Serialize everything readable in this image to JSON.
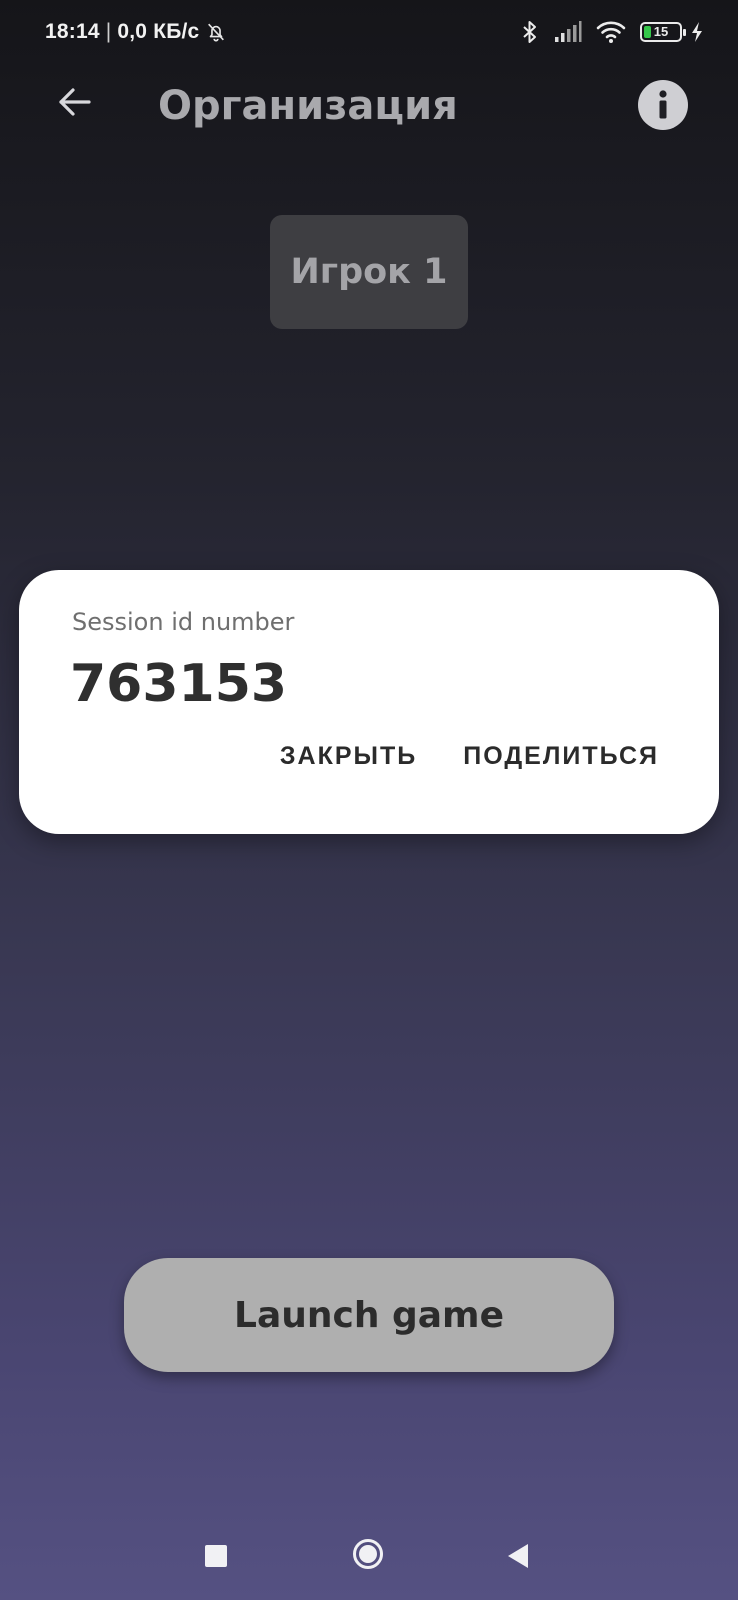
{
  "status_bar": {
    "time": "18:14",
    "separator": "|",
    "network_speed": "0,0 КБ/с",
    "battery_level": "15",
    "icons": [
      "bell-off-icon",
      "bluetooth-icon",
      "signal-icon",
      "wifi-icon",
      "battery-icon",
      "charging-bolt-icon"
    ]
  },
  "app_bar": {
    "title": "Организация",
    "back_icon": "arrow-left-icon",
    "info_icon": "info-icon"
  },
  "player": {
    "label": "Игрок 1"
  },
  "dialog": {
    "label": "Session id number",
    "value": "763153",
    "close_label": "ЗАКРЫТЬ",
    "share_label": "ПОДЕЛИТЬСЯ"
  },
  "launch": {
    "label": "Launch game"
  },
  "nav_bar": {
    "icons": [
      "recents-square-icon",
      "home-circle-icon",
      "back-triangle-icon"
    ]
  },
  "colors": {
    "background_top": "#151519",
    "background_bottom": "#555182",
    "dialog_bg": "#ffffff",
    "launch_button_bg": "#afafaf",
    "battery_fill": "#35c64a"
  }
}
